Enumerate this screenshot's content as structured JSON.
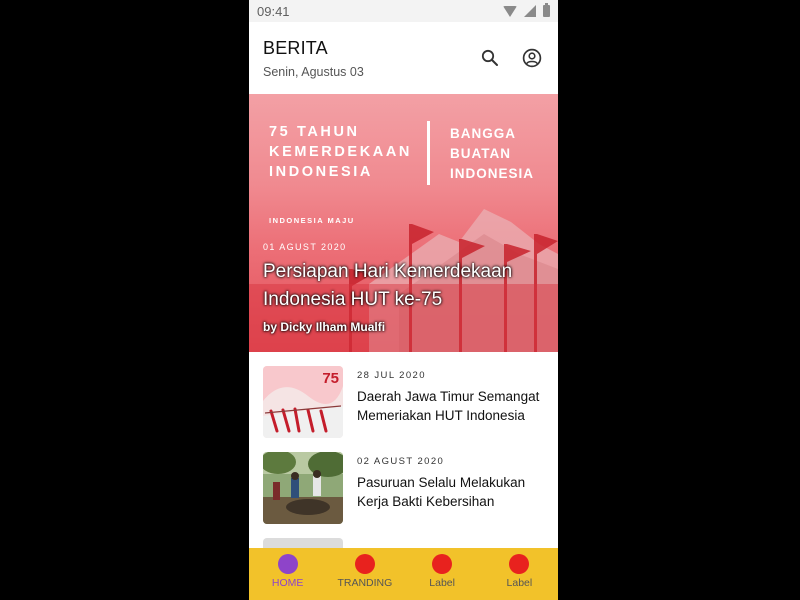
{
  "status_bar": {
    "time": "09:41"
  },
  "header": {
    "title": "BERITA",
    "date": "Senin, Agustus 03"
  },
  "hero": {
    "banner_left": [
      "75 TAHUN",
      "KEMERDEKAAN",
      "INDONESIA"
    ],
    "banner_right": [
      "BANGGA",
      "BUATAN",
      "INDONESIA"
    ],
    "banner_tag": "INDONESIA MAJU",
    "date": "01 AGUST 2020",
    "title": "Persiapan Hari Kemerdekaan Indonesia HUT ke-75",
    "author": "by Dicky Ilham Mualfi"
  },
  "news": [
    {
      "date": "28 JUL 2020",
      "title": "Daerah Jawa Timur Semangat Memeriakan HUT Indonesia",
      "thumb_text": "75"
    },
    {
      "date": "02 AGUST 2020",
      "title": "Pasuruan Selalu Melakukan Kerja Bakti Kebersihan"
    }
  ],
  "bottom_nav": [
    {
      "label": "HOME",
      "active": true
    },
    {
      "label": "TRANDING",
      "active": false
    },
    {
      "label": "Label",
      "active": false
    },
    {
      "label": "Label",
      "active": false
    }
  ],
  "colors": {
    "nav_background": "#f2c22a",
    "nav_active": "#8e44c9",
    "nav_inactive_dot": "#e8221e"
  },
  "icons": {
    "search": "search-icon",
    "account": "account-circle-icon"
  }
}
